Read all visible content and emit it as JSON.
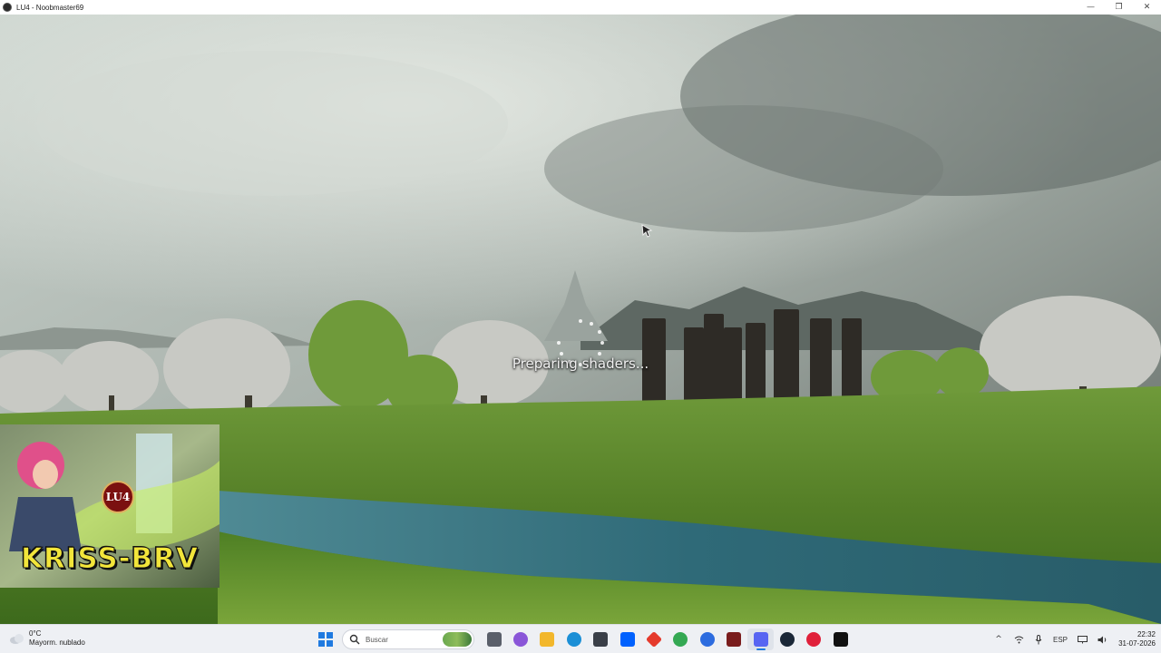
{
  "window": {
    "title": "LU4 - Noobmaster69",
    "minimize_symbol": "—",
    "maximize_symbol": "❐",
    "close_symbol": "✕"
  },
  "game": {
    "loading_text": "Preparing shaders..."
  },
  "overlay": {
    "channel_name": "KRISS-BRV",
    "logo_text": "LU4"
  },
  "taskbar": {
    "weather": {
      "temperature": "0°C",
      "description": "Mayorm. nublado"
    },
    "search_placeholder": "Buscar",
    "apps": [
      {
        "name": "task-view-icon",
        "color": "#5a5f6a"
      },
      {
        "name": "copilot-icon",
        "color": "#8a56d8"
      },
      {
        "name": "file-explorer-icon",
        "color": "#f2b72c"
      },
      {
        "name": "edge-icon",
        "color": "#1b8fd6"
      },
      {
        "name": "store-icon",
        "color": "#3a3f48"
      },
      {
        "name": "dropbox-icon",
        "color": "#0061fe"
      },
      {
        "name": "app-red-diamond-icon",
        "color": "#e53a2c"
      },
      {
        "name": "chrome-icon",
        "color": "#34a853"
      },
      {
        "name": "app-blue-circle-icon",
        "color": "#2d6cdf"
      },
      {
        "name": "app-dark-red-icon",
        "color": "#7a1d1d"
      },
      {
        "name": "discord-icon",
        "color": "#5865f2"
      },
      {
        "name": "steam-icon",
        "color": "#1b2838"
      },
      {
        "name": "app-red-play-icon",
        "color": "#e0203a"
      },
      {
        "name": "unreal-engine-icon",
        "color": "#111111"
      }
    ],
    "tray": {
      "chevron": "^",
      "language": "ESP",
      "time": "22:32",
      "date": "31-07-2026"
    }
  }
}
